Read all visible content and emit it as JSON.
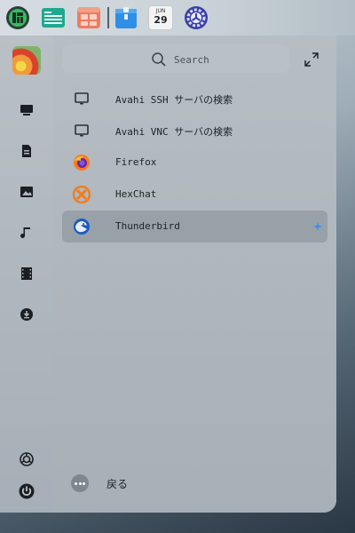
{
  "dock": {
    "items": [
      {
        "icon": "manjaro-logo-icon"
      },
      {
        "icon": "file-manager-icon"
      },
      {
        "icon": "app-store-icon"
      },
      {
        "icon": "package-icon"
      },
      {
        "icon": "calendar-icon",
        "month": "JUN",
        "day": "29"
      },
      {
        "icon": "settings-gear-icon"
      }
    ],
    "calendar": {
      "month": "JUN",
      "day": "29"
    }
  },
  "sidebar": {
    "items": [
      {
        "icon": "computer-icon"
      },
      {
        "icon": "document-icon"
      },
      {
        "icon": "picture-icon"
      },
      {
        "icon": "music-icon"
      },
      {
        "icon": "film-icon"
      },
      {
        "icon": "download-icon"
      }
    ],
    "bottom": [
      {
        "icon": "settings-icon"
      },
      {
        "icon": "power-icon"
      }
    ]
  },
  "search": {
    "placeholder": "Search"
  },
  "apps": [
    {
      "label": "Avahi SSH サーバの検索",
      "icon": "monitor-icon",
      "selected": false
    },
    {
      "label": "Avahi VNC サーバの検索",
      "icon": "monitor-icon",
      "selected": false
    },
    {
      "label": "Firefox",
      "icon": "firefox-icon",
      "selected": false
    },
    {
      "label": "HexChat",
      "icon": "hexchat-icon",
      "selected": false
    },
    {
      "label": "Thunderbird",
      "icon": "thunderbird-icon",
      "selected": true
    }
  ],
  "back": {
    "label": "戻る"
  },
  "colors": {
    "accent": "#3d8ee8",
    "selected_row": "#98a1a8"
  }
}
